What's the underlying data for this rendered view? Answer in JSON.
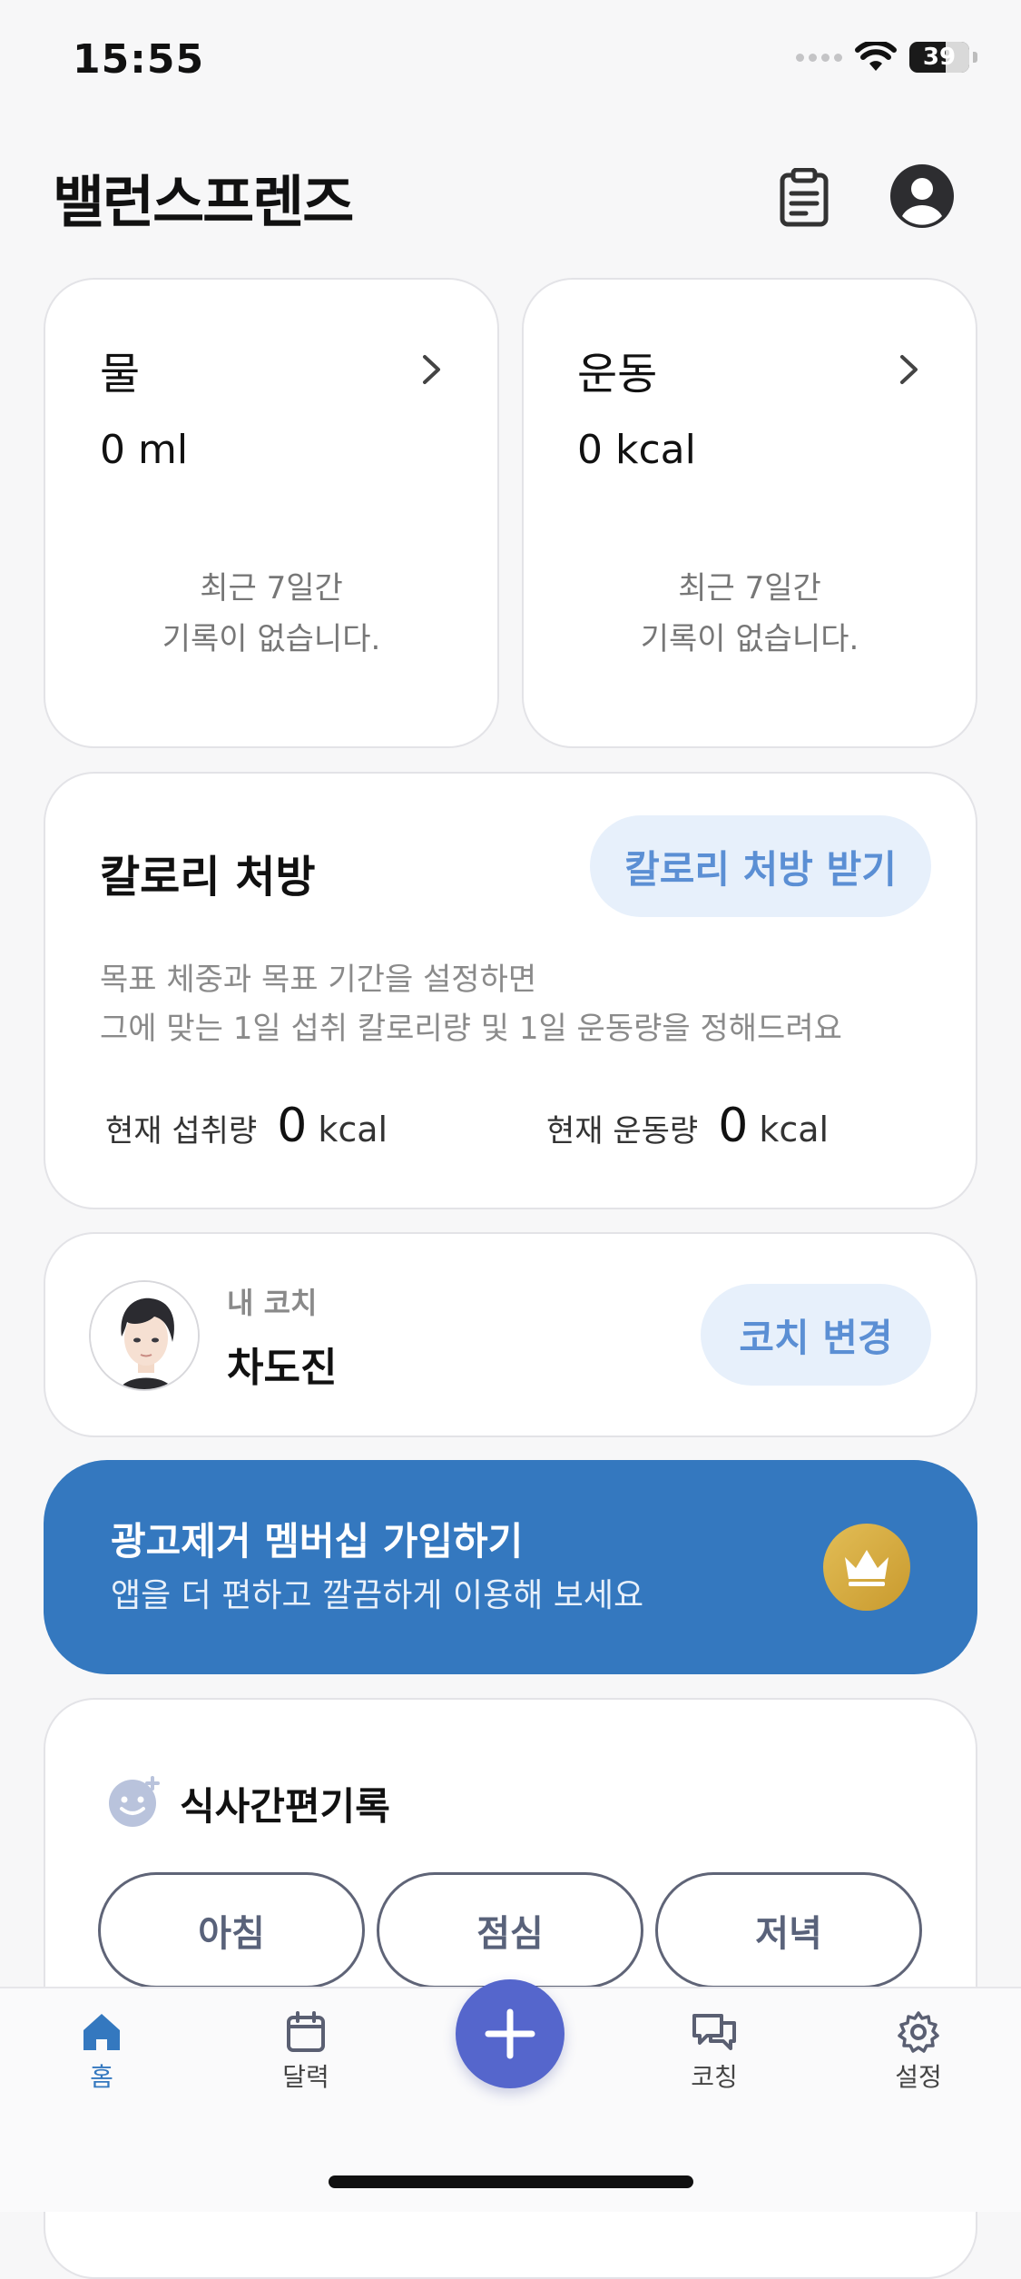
{
  "status_bar": {
    "time": "15:55",
    "battery": "39"
  },
  "header": {
    "title": "밸런스프렌즈"
  },
  "water_card": {
    "title": "물",
    "value": "0 ml",
    "empty_line1": "최근 7일간",
    "empty_line2": "기록이 없습니다."
  },
  "exercise_card": {
    "title": "운동",
    "value": "0 kcal",
    "empty_line1": "최근 7일간",
    "empty_line2": "기록이 없습니다."
  },
  "calorie_card": {
    "title": "칼로리 처방",
    "button": "칼로리 처방 받기",
    "desc_line1": "목표 체중과 목표 기간을 설정하면",
    "desc_line2": "그에 맞는 1일 섭취 칼로리량 및 1일 운동량을 정해드려요",
    "intake_label": "현재 섭취량",
    "intake_value": "0",
    "intake_unit": "kcal",
    "exercise_label": "현재 운동량",
    "exercise_value": "0",
    "exercise_unit": "kcal"
  },
  "coach_card": {
    "label": "내 코치",
    "name": "차도진",
    "button": "코치 변경"
  },
  "banner": {
    "title": "광고제거 멤버십 가입하기",
    "subtitle": "앱을 더 편하고 깔끔하게 이용해 보세요"
  },
  "meal_card": {
    "title": "식사간편기록",
    "buttons": [
      "아침",
      "점심",
      "저녁"
    ]
  },
  "tabbar": {
    "tabs": [
      "홈",
      "달력",
      "코칭",
      "설정"
    ],
    "active": "홈"
  },
  "colors": {
    "accent_blue": "#3478bf",
    "pill_bg": "#e7f0fb",
    "pill_text": "#5b8fd4",
    "fab": "#5566cc",
    "gold": "#d4aa3e"
  }
}
